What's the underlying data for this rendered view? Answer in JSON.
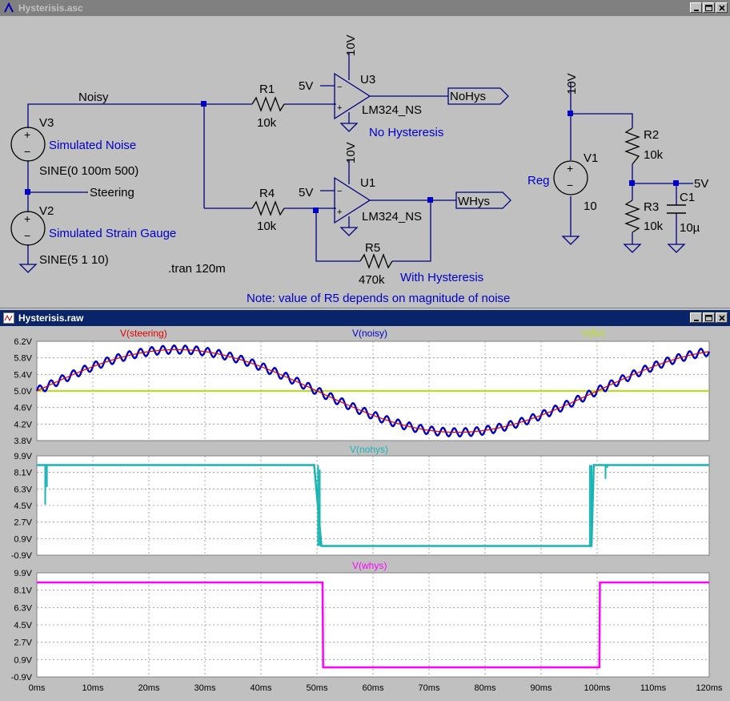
{
  "schematic_window": {
    "title": "Hysterisis.asc",
    "labels": {
      "noisy": "Noisy",
      "steering": "Steering",
      "v3": "V3",
      "v3_desc": "Simulated Noise",
      "v3_src": "SINE(0 100m 500)",
      "v2": "V2",
      "v2_desc": "Simulated Strain Gauge",
      "v2_src": "SINE(5 1 10)",
      "tran": ".tran 120m",
      "r1": "R1",
      "r1_val": "10k",
      "r4": "R4",
      "r4_val": "10k",
      "r5": "R5",
      "r5_val": "470k",
      "u3": "U3",
      "u3_model": "LM324_NS",
      "u3_supply": "10V",
      "u3_ref": "5V",
      "u1": "U1",
      "u1_model": "LM324_NS",
      "u1_supply": "10V",
      "u1_ref": "5V",
      "nohys_net": "NoHys",
      "whys_net": "WHys",
      "no_hys_note": "No Hysteresis",
      "with_hys_note": "With Hysteresis",
      "note": "Note: value of R5 depends on magnitude of noise",
      "v1_supply": "10V",
      "reg": "Reg",
      "v1": "V1",
      "v1_val": "10",
      "r2": "R2",
      "r2_val": "10k",
      "r3": "R3",
      "r3_val": "10k",
      "c1": "C1",
      "c1_val": "10µ",
      "fivev_net": "5V"
    }
  },
  "plot_window": {
    "title": "Hysterisis.raw"
  },
  "colors": {
    "steering": "#e00000",
    "noisy": "#0000c8",
    "fivev": "#b4e60a",
    "nohys": "#19b4b4",
    "whys": "#ff00ff",
    "schematic_blue": "#0000c8",
    "wire": "#000080"
  },
  "chart_data": [
    {
      "type": "line",
      "title": "",
      "xlabel": "",
      "ylabel": "",
      "xlim": [
        0,
        120
      ],
      "ylim": [
        3.8,
        6.2
      ],
      "x_ticks": [
        "0ms",
        "10ms",
        "20ms",
        "30ms",
        "40ms",
        "50ms",
        "60ms",
        "70ms",
        "80ms",
        "90ms",
        "100ms",
        "110ms",
        "120ms"
      ],
      "y_ticks": [
        "6.2V",
        "5.8V",
        "5.4V",
        "5.0V",
        "4.6V",
        "4.2V",
        "3.8V"
      ],
      "series": [
        {
          "name": "V(steering)",
          "expr": "5 + sin(2*pi*10*t)",
          "x": [
            0,
            12.5,
            25,
            37.5,
            50,
            62.5,
            75,
            87.5,
            100,
            112.5,
            120
          ],
          "values": [
            5.0,
            5.71,
            6.0,
            5.71,
            5.0,
            4.29,
            4.0,
            4.29,
            5.0,
            5.71,
            5.95
          ]
        },
        {
          "name": "V(noisy)",
          "expr": "5 + sin(2*pi*10*t) + 0.1*sin(2*pi*500*t)",
          "x": [
            0,
            12.5,
            25,
            37.5,
            50,
            62.5,
            75,
            87.5,
            100,
            112.5,
            120
          ],
          "values": [
            5.0,
            5.71,
            6.0,
            5.71,
            5.0,
            4.29,
            4.0,
            4.29,
            5.0,
            5.71,
            5.95
          ]
        },
        {
          "name": "V(5v)",
          "values": [
            5.0,
            5.0
          ]
        }
      ]
    },
    {
      "type": "line",
      "title": "V(nohys)",
      "xlim": [
        0,
        120
      ],
      "ylim": [
        -0.9,
        9.9
      ],
      "y_ticks": [
        "9.9V",
        "8.1V",
        "6.3V",
        "4.5V",
        "2.7V",
        "0.9V",
        "-0.9V"
      ],
      "series": [
        {
          "name": "V(nohys)",
          "x": [
            0,
            49.5,
            50.8,
            51,
            99,
            99.4,
            100,
            101.5,
            120
          ],
          "values": [
            8.9,
            8.9,
            0.1,
            0.1,
            0.1,
            8.9,
            8.9,
            8.9,
            8.9
          ]
        }
      ]
    },
    {
      "type": "line",
      "title": "V(whys)",
      "xlim": [
        0,
        120
      ],
      "ylim": [
        -0.9,
        9.9
      ],
      "y_ticks": [
        "9.9V",
        "8.1V",
        "6.3V",
        "4.5V",
        "2.7V",
        "0.9V",
        "-0.9V"
      ],
      "series": [
        {
          "name": "V(whys)",
          "x": [
            0,
            51,
            51.1,
            100.4,
            100.5,
            120
          ],
          "values": [
            8.9,
            8.9,
            0.1,
            0.1,
            8.9,
            8.9
          ]
        }
      ]
    }
  ]
}
